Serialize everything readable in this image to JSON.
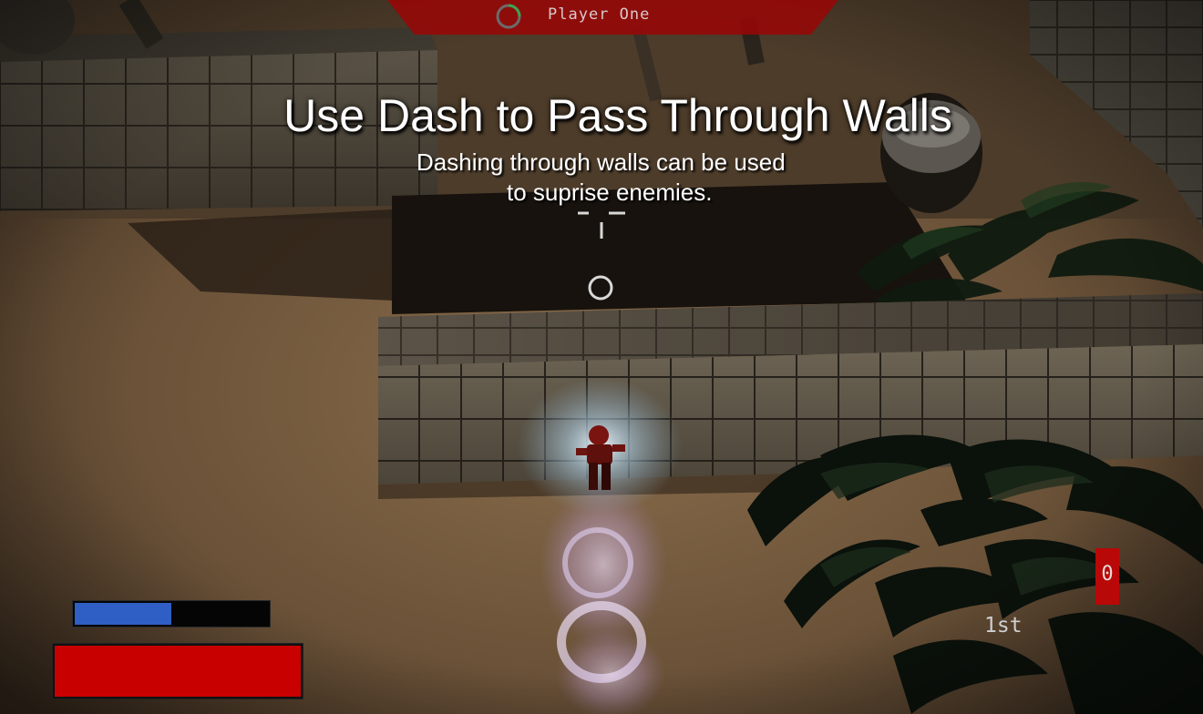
{
  "hud": {
    "player_name": "Player One",
    "team_color": "#b00000",
    "score": "0",
    "rank": "1st",
    "dash_charge": 0.5,
    "health": 1.0,
    "dash_color": "#2f5ec4",
    "health_color": "#c90000"
  },
  "tutorial": {
    "title": "Use Dash to Pass Through Walls",
    "subtitle_line1": "Dashing through walls can be used",
    "subtitle_line2": "to suprise enemies."
  },
  "icons": {
    "player_indicator": "circular-ring-icon",
    "crosshair": "crosshair-icon",
    "aim_reticle": "aim-ring-icon"
  }
}
